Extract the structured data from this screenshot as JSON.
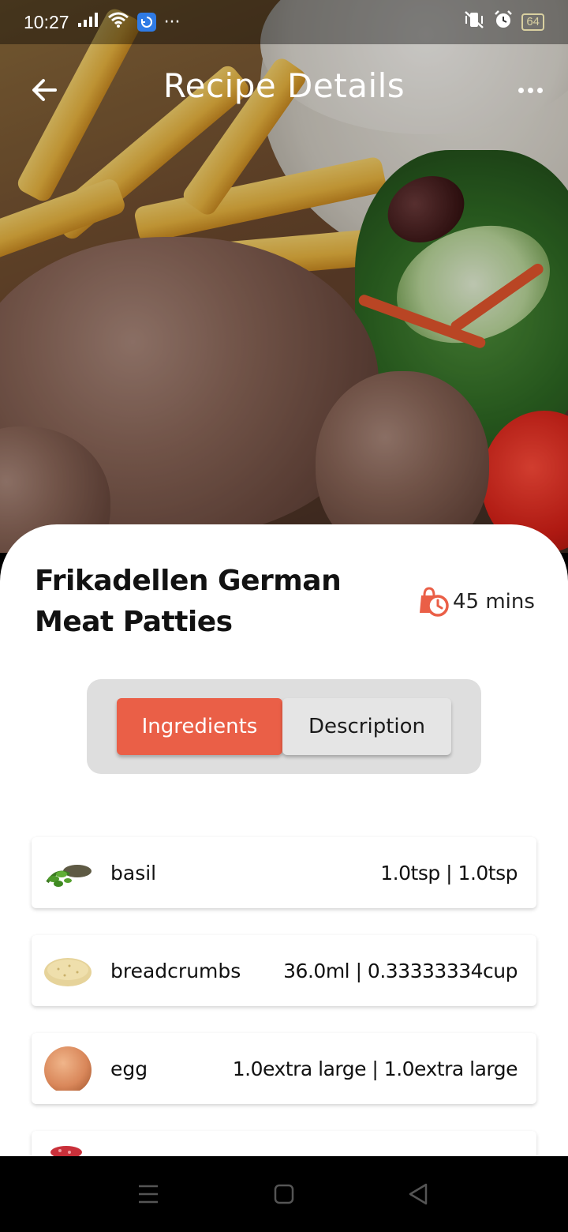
{
  "status_bar": {
    "time": "10:27",
    "overflow": "···",
    "battery": "64",
    "icons": [
      "signal-icon",
      "wifi-icon",
      "app-notification-icon",
      "vibrate-icon",
      "alarm-icon",
      "battery-icon"
    ]
  },
  "app_bar": {
    "title": "Recipe Details",
    "back_icon": "arrow-left-icon",
    "more_icon": "more-horizontal-icon"
  },
  "recipe": {
    "title": "Frikadellen German Meat Patties",
    "time": "45 mins",
    "time_icon": "timer-bag-icon",
    "accent_color": "#ea5f47"
  },
  "tabs": [
    {
      "label": "Ingredients",
      "active": true
    },
    {
      "label": "Description",
      "active": false
    }
  ],
  "ingredients": [
    {
      "name": "basil",
      "quantity": "1.0tsp | 1.0tsp",
      "thumb": "basil"
    },
    {
      "name": "breadcrumbs",
      "quantity": "36.0ml | 0.33333334cup",
      "thumb": "breadcrumbs"
    },
    {
      "name": "egg",
      "quantity": "1.0extra large | 1.0extra large",
      "thumb": "egg"
    },
    {
      "name": "",
      "quantity": "",
      "thumb": "meat"
    }
  ],
  "nav_bar": {
    "icons": [
      "menu-icon",
      "home-square-icon",
      "back-triangle-icon"
    ]
  }
}
